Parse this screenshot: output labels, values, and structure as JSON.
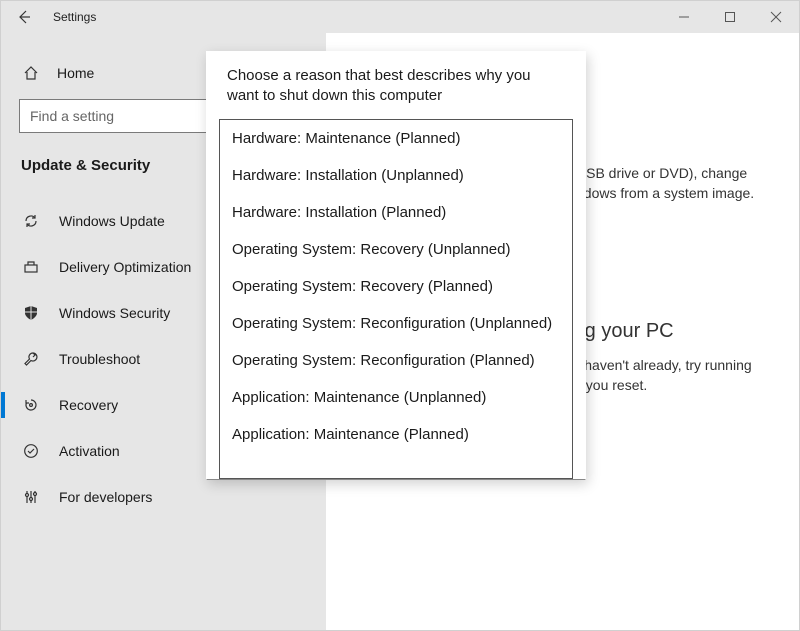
{
  "titlebar": {
    "title": "Settings"
  },
  "sidebar": {
    "home": "Home",
    "search_placeholder": "Find a setting",
    "section": "Update & Security",
    "items": [
      {
        "label": "Windows Update"
      },
      {
        "label": "Delivery Optimization"
      },
      {
        "label": "Windows Security"
      },
      {
        "label": "Troubleshoot"
      },
      {
        "label": "Recovery"
      },
      {
        "label": "Activation"
      },
      {
        "label": "For developers"
      }
    ],
    "selected_index": 4
  },
  "main": {
    "bg_line1_fragment": "USB drive or DVD), change",
    "bg_line2_fragment": "ndows from a system image.",
    "reset_heading_fragment": "tting your PC",
    "reset_body1_fragment": "f you haven't already, try running",
    "reset_body2_fragment": "efore you reset."
  },
  "shutdown_popup": {
    "prompt": "Choose a reason that best describes why you want to shut down this computer",
    "options": [
      "Hardware: Maintenance (Planned)",
      "Hardware: Installation (Unplanned)",
      "Hardware: Installation (Planned)",
      "Operating System: Recovery (Unplanned)",
      "Operating System: Recovery (Planned)",
      "Operating System: Reconfiguration (Unplanned)",
      "Operating System: Reconfiguration (Planned)",
      "Application: Maintenance (Unplanned)",
      "Application: Maintenance (Planned)"
    ]
  }
}
